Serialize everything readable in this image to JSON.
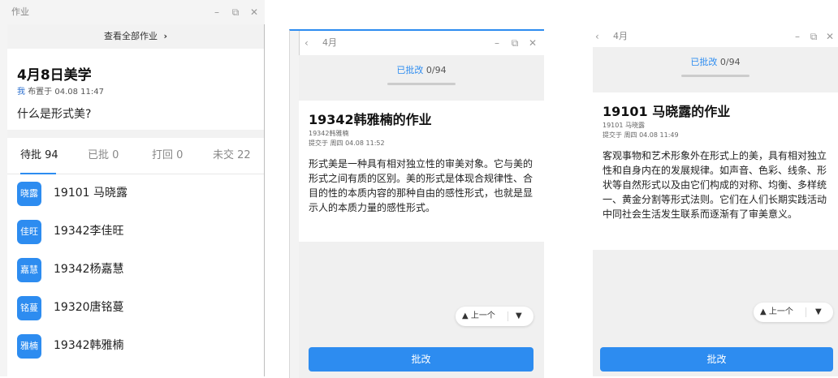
{
  "homework_list": {
    "window_title": "作业",
    "view_all": "查看全部作业",
    "view_all_arrow": "›",
    "task": {
      "title": "4月8日美学",
      "author": "我",
      "meta": "布置于 04.08 11:47",
      "question": "什么是形式美?"
    },
    "tabs": [
      {
        "label": "待批 94",
        "active": true
      },
      {
        "label": "已批 0",
        "active": false
      },
      {
        "label": "打回 0",
        "active": false
      },
      {
        "label": "未交 22",
        "active": false
      }
    ],
    "students": [
      {
        "avatar": "晓露",
        "name": "19101 马晓露"
      },
      {
        "avatar": "佳旺",
        "name": "19342李佳旺"
      },
      {
        "avatar": "嘉慧",
        "name": "19342杨嘉慧"
      },
      {
        "avatar": "铭蔓",
        "name": "19320唐铭蔓"
      },
      {
        "avatar": "雅楠",
        "name": "19342韩雅楠"
      }
    ]
  },
  "window_controls": {
    "minimize": "–",
    "restore": "⧉",
    "close": "✕",
    "back": "‹"
  },
  "detail_left": {
    "window_title": "4月",
    "status_label": "已批改",
    "status_count": "0/94",
    "title": "19342韩雅楠的作业",
    "student": "19342韩雅楠",
    "meta": "提交于  周四 04.08 11:52",
    "answer": "形式美是一种具有相对独立性的审美对象。它与美的形式之间有质的区别。美的形式是体现合规律性、合目的性的本质内容的那种自由的感性形式，也就是显示人的本质力量的感性形式。",
    "prev_label": "▲ 上一个",
    "next_icon": "▼",
    "grade_button": "批改"
  },
  "detail_right": {
    "window_title": "4月",
    "status_label": "已批改",
    "status_count": "0/94",
    "title": "19101 马晓露的作业",
    "student": "19101 马晓露",
    "meta": "提交于  周四 04.08 11:49",
    "answer": "客观事物和艺术形象外在形式上的美，具有相对独立性和自身内在的发展规律。如声音、色彩、线条、形状等自然形式以及由它们构成的对称、均衡、多样统一、黄金分割等形式法则。它们在人们长期实践活动中同社会生活发生联系而逐渐有了审美意义。",
    "prev_label": "▲ 上一个",
    "next_icon": "▼",
    "grade_button": "批改"
  }
}
